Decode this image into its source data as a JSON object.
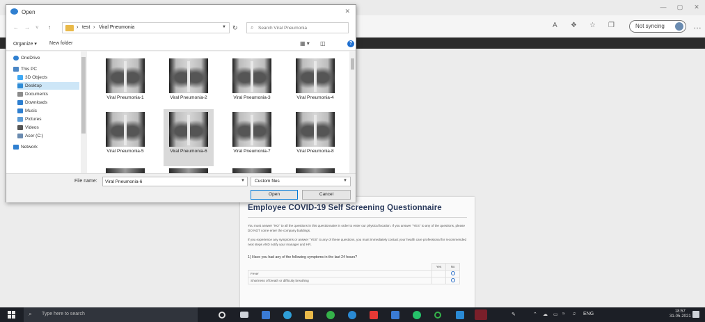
{
  "browser": {
    "sync_label": "Not syncing",
    "more_icon": "ellipsis-icon"
  },
  "dialog": {
    "title": "Open",
    "path": [
      "test",
      "Viral Pneumonia"
    ],
    "search_placeholder": "Search Viral Pneumonia",
    "organize_label": "Organize",
    "new_folder_label": "New folder",
    "nav_items": [
      {
        "label": "OneDrive",
        "icon": "cloud-icon",
        "color": "#2f7fd0"
      },
      {
        "label": "This PC",
        "icon": "computer-icon",
        "color": "#4a86c5"
      },
      {
        "label": "3D Objects",
        "icon": "cube-icon",
        "color": "#3fa9f5"
      },
      {
        "label": "Desktop",
        "icon": "desktop-icon",
        "color": "#2e8bd6"
      },
      {
        "label": "Documents",
        "icon": "document-icon",
        "color": "#8b8b8b"
      },
      {
        "label": "Downloads",
        "icon": "download-icon",
        "color": "#2e7fd0"
      },
      {
        "label": "Music",
        "icon": "music-icon",
        "color": "#2e7fd0"
      },
      {
        "label": "Pictures",
        "icon": "picture-icon",
        "color": "#5b9bd5"
      },
      {
        "label": "Videos",
        "icon": "video-icon",
        "color": "#555555"
      },
      {
        "label": "Acer (C:)",
        "icon": "drive-icon",
        "color": "#6a8bb0"
      },
      {
        "label": "Network",
        "icon": "network-icon",
        "color": "#2f7fd0"
      }
    ],
    "selected_nav_index": 3,
    "files": [
      {
        "name": "Viral Pneumonia-1"
      },
      {
        "name": "Viral Pneumonia-2"
      },
      {
        "name": "Viral Pneumonia-3"
      },
      {
        "name": "Viral Pneumonia-4"
      },
      {
        "name": "Viral Pneumonia-5"
      },
      {
        "name": "Viral Pneumonia-6"
      },
      {
        "name": "Viral Pneumonia-7"
      },
      {
        "name": "Viral Pneumonia-8"
      }
    ],
    "selected_file_index": 5,
    "filename_label": "File name:",
    "filename_value": "Viral Pneumonia-6",
    "filetype_value": "Custom files",
    "open_label": "Open",
    "cancel_label": "Cancel"
  },
  "questionnaire": {
    "title": "Employee COVID-19 Self Screening Questionnaire",
    "para1": "You must answer \"NO\" to all the questions in this questionnaire in order to enter our physical location. If you answer \"YES\" to any of the questions, please DO NOT come enter the company buildings.",
    "para2": "If you experience any symptoms or answer \"YES\" to any of these questions, you must immediately contact your health care professional for recommended next steps AND notify your manager and HR.",
    "question": "1) Have you had any of the following symptoms in the last 24 hours?",
    "col_yes": "Yes",
    "col_no": "No",
    "rows": [
      "Fever",
      "Shortness of breath or difficulty breathing"
    ]
  },
  "taskbar": {
    "search_placeholder": "Type here to search",
    "lang": "ENG",
    "time": "18:57",
    "date": "31-05-2021"
  }
}
